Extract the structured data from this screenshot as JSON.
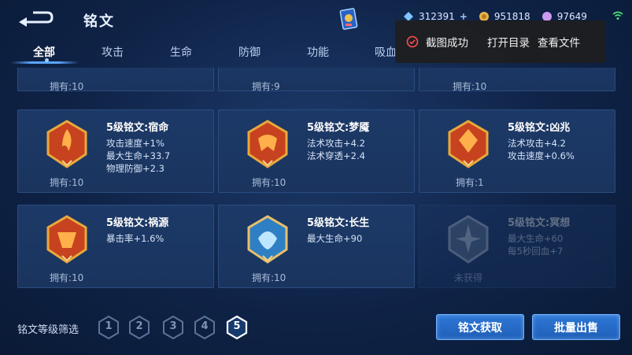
{
  "header": {
    "title": "铭文",
    "currencies": [
      {
        "icon": "diamond-icon",
        "value": "312391",
        "color": "#7fc4ff"
      },
      {
        "icon": "gold-coin-icon",
        "value": "951818",
        "color": "#e8b44a"
      },
      {
        "icon": "gem-icon",
        "value": "97649",
        "color": "#c99bf0"
      }
    ]
  },
  "tabs": [
    {
      "label": "全部",
      "active": true
    },
    {
      "label": "攻击",
      "active": false
    },
    {
      "label": "生命",
      "active": false
    },
    {
      "label": "防御",
      "active": false
    },
    {
      "label": "功能",
      "active": false
    },
    {
      "label": "吸血",
      "active": false
    }
  ],
  "toast": {
    "message": "截图成功",
    "open_dir": "打开目录",
    "view_file": "查看文件"
  },
  "top_row_partial": [
    {
      "owned": "拥有:10"
    },
    {
      "owned": "拥有:9"
    },
    {
      "owned": "拥有:10"
    }
  ],
  "inscriptions": [
    {
      "name": "5级铭文:宿命",
      "stats": [
        "攻击速度+1%",
        "最大生命+33.7",
        "物理防御+2.3"
      ],
      "owned": "拥有:10",
      "color": "#d94a2a"
    },
    {
      "name": "5级铭文:梦魇",
      "stats": [
        "法术攻击+4.2",
        "法术穿透+2.4"
      ],
      "owned": "拥有:10",
      "color": "#d94a2a"
    },
    {
      "name": "5级铭文:凶兆",
      "stats": [
        "法术攻击+4.2",
        "攻击速度+0.6%"
      ],
      "owned": "拥有:1",
      "color": "#d94a2a"
    },
    {
      "name": "5级铭文:祸源",
      "stats": [
        "暴击率+1.6%"
      ],
      "owned": "拥有:10",
      "color": "#d94a2a"
    },
    {
      "name": "5级铭文:长生",
      "stats": [
        "最大生命+90"
      ],
      "owned": "拥有:10",
      "color": "#3a8fd0"
    },
    {
      "name": "5级铭文:冥想",
      "stats": [
        "最大生命+60",
        "每5秒回血+7"
      ],
      "owned": "未获得",
      "color": "#3a8fd0"
    }
  ],
  "footer": {
    "filter_label": "铭文等级筛选",
    "levels": [
      "1",
      "2",
      "3",
      "4",
      "5"
    ],
    "active_level": "5",
    "acquire_button": "铭文获取",
    "bulk_sell_button": "批量出售"
  }
}
